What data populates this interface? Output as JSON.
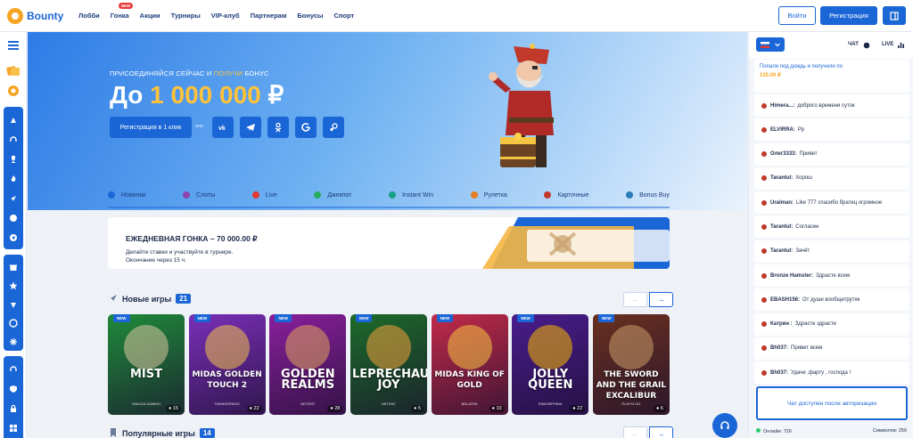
{
  "brand": {
    "name": "Bounty"
  },
  "nav": {
    "items": [
      "Лобби",
      "Гонка",
      "Акции",
      "Турниры",
      "VIP-клуб",
      "Партнерам",
      "Бонусы",
      "Спорт"
    ],
    "badge": "NEW"
  },
  "auth": {
    "login": "Войти",
    "register": "Регистрация"
  },
  "hero": {
    "kicker_prefix": "ПРИСОЕДИНЯЙСЯ СЕЙЧАС И ",
    "kicker_highlight": "ПОЛУЧИ",
    "kicker_suffix": " БОНУС",
    "amount_prefix": "До ",
    "amount_value": "1 000 000",
    "amount_currency": " ₽",
    "cta": "Регистрация в 1 клик",
    "or": "или"
  },
  "categories": [
    {
      "label": "Новинки",
      "color": "#1b66d6"
    },
    {
      "label": "Слоты",
      "color": "#8e44ad"
    },
    {
      "label": "Live",
      "color": "#e53935"
    },
    {
      "label": "Джекпот",
      "color": "#27ae60"
    },
    {
      "label": "Instant Win",
      "color": "#16a085"
    },
    {
      "label": "Рулетка",
      "color": "#e67e22"
    },
    {
      "label": "Карточные",
      "color": "#c0392b"
    },
    {
      "label": "Bonus Buy",
      "color": "#2980b9"
    }
  ],
  "race": {
    "title": "ЕЖЕДНЕВНАЯ ГОНКА – 70 000.00 ₽",
    "line1": "Делайте ставки и участвуйте в турнире.",
    "line2": "Окончание через 15 ч."
  },
  "new_games": {
    "title": "Новые игры",
    "count": "21",
    "items": [
      {
        "badge": "NEW",
        "title": "MIST",
        "provider": "YAKUZA GAMING",
        "count": "15",
        "bg": "#1f8a3a",
        "accent": "#d8c7a0"
      },
      {
        "badge": "NEW",
        "title": "MIDAS GOLDEN TOUCH 2",
        "provider": "THUNDERKICK",
        "count": "22",
        "bg": "#7a2fb8",
        "accent": "#f2c14e"
      },
      {
        "badge": "NEW",
        "title": "GOLDEN REALMS",
        "provider": "NETENT",
        "count": "28",
        "bg": "#8a1f9c",
        "accent": "#e0a45c"
      },
      {
        "badge": "NEW",
        "title": "LEPRECHAUN JOY",
        "provider": "NETENT",
        "count": "5",
        "bg": "#1c6b2a",
        "accent": "#f2a33a"
      },
      {
        "badge": "NEW",
        "title": "MIDAS KING OF GOLD",
        "provider": "BELATRA",
        "count": "10",
        "bg": "#c22a4a",
        "accent": "#f5c542"
      },
      {
        "badge": "NEW",
        "title": "JOLLY QUEEN",
        "provider": "ENDORPHINA",
        "count": "22",
        "bg": "#4a1c8c",
        "accent": "#f5b800"
      },
      {
        "badge": "NEW",
        "title": "THE SWORD AND THE GRAIL EXCALIBUR",
        "provider": "PLAY'N GO",
        "count": "6",
        "bg": "#6a3020",
        "accent": "#c99a6a"
      }
    ]
  },
  "popular": {
    "title": "Популярные игры",
    "count": "14"
  },
  "chat": {
    "tab_chat": "ЧАТ",
    "tab_live": "LIVE",
    "first_line1": "Попали под  дождь  и получили по",
    "first_line2": "125.00 ₽",
    "messages": [
      {
        "name": "Himera...:",
        "text": "доброго времени суток"
      },
      {
        "name": "ELVIRRA:",
        "text": "Рр"
      },
      {
        "name": "Олег3333:",
        "text": "Привет"
      },
      {
        "name": "Tarantul:",
        "text": "Хорош"
      },
      {
        "name": "Uralman:",
        "text": "Like 777 спасибо братец огромное"
      },
      {
        "name": "Tarantul:",
        "text": "Согласен"
      },
      {
        "name": "Tarantul:",
        "text": "Зачёт"
      },
      {
        "name": "Bronze Hamster:",
        "text": "Здрасте всем"
      },
      {
        "name": "EBASH156:",
        "text": "От души вообщетрутяк"
      },
      {
        "name": "Катрин :",
        "text": "Здрасте здрасте"
      },
      {
        "name": "Bh037:",
        "text": "Привет всем"
      },
      {
        "name": "Bh037:",
        "text": "Удачи ,фарту , господа !"
      }
    ],
    "auth_notice": "Чат доступен после авторизации",
    "online_label": "Онлайн: 726",
    "symbols_label": "Символов: 256"
  }
}
